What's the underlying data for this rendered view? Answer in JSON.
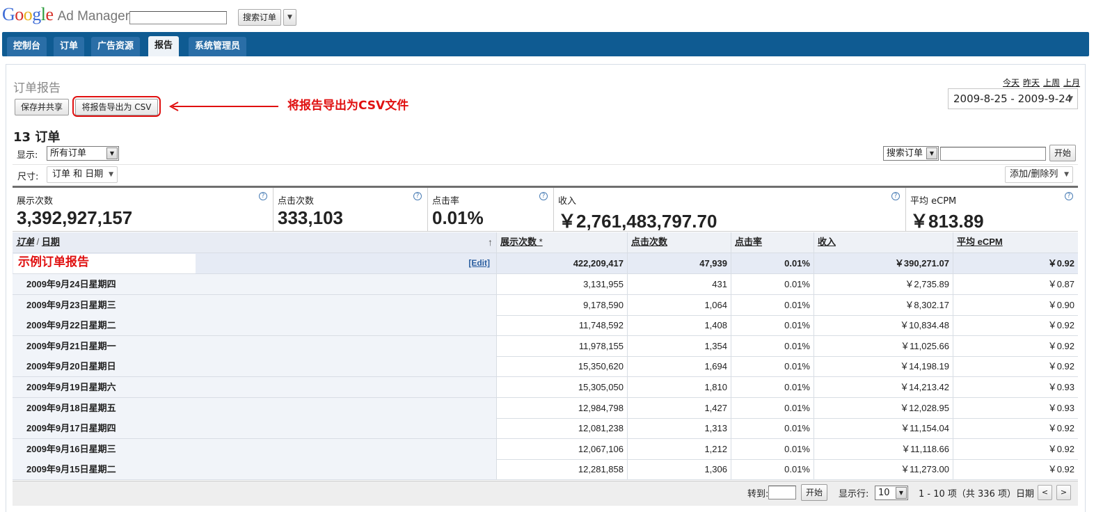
{
  "header": {
    "logo_google": "Google",
    "logo_product": "Ad Manager",
    "search_value": "",
    "search_button": "搜索订单",
    "dropdown_icon": "triangle-down"
  },
  "nav": {
    "tabs": [
      "控制台",
      "订单",
      "广告资源",
      "报告",
      "系统管理员"
    ],
    "active_tab": "报告"
  },
  "page": {
    "title": "订单报告",
    "save_share_button": "保存并共享",
    "export_csv_button": "将报告导出为 CSV",
    "annotation_top": "将报告导出为CSV文件",
    "date_shortcuts": [
      "今天",
      "昨天",
      "上周",
      "上月"
    ],
    "date_range": "2009-8-25 - 2009-9-24",
    "count_title": "13 订单",
    "show_label": "显示:",
    "show_value": "所有订单",
    "search_scope": "搜索订单",
    "search_input": "",
    "search_go": "开始",
    "dimension_label": "尺寸:",
    "dimension_value": "订单 和 日期",
    "add_remove_columns": "添加/删除列"
  },
  "summary": [
    {
      "label": "展示次数",
      "value": "3,392,927,157"
    },
    {
      "label": "点击次数",
      "value": "333,103"
    },
    {
      "label": "点击率",
      "value": "0.01%"
    },
    {
      "label": "收入",
      "value": "￥2,761,483,797.70"
    },
    {
      "label": "平均 eCPM",
      "value": "￥813.89"
    }
  ],
  "table": {
    "header_first": {
      "order": "订单",
      "sep": "/",
      "date": "日期"
    },
    "sort_icon": "↑",
    "columns": [
      "展示次数",
      "点击次数",
      "点击率",
      "收入",
      "平均 eCPM"
    ],
    "impressions_marker": "*",
    "group": {
      "name": "示例订单报告",
      "edit": "[Edit]",
      "impressions": "422,209,417",
      "clicks": "47,939",
      "ctr": "0.01%",
      "revenue": "￥390,271.07",
      "ecpm": "￥0.92"
    },
    "rows": [
      {
        "date": "2009年9月24日星期四",
        "impressions": "3,131,955",
        "clicks": "431",
        "ctr": "0.01%",
        "revenue": "￥2,735.89",
        "ecpm": "￥0.87"
      },
      {
        "date": "2009年9月23日星期三",
        "impressions": "9,178,590",
        "clicks": "1,064",
        "ctr": "0.01%",
        "revenue": "￥8,302.17",
        "ecpm": "￥0.90"
      },
      {
        "date": "2009年9月22日星期二",
        "impressions": "11,748,592",
        "clicks": "1,408",
        "ctr": "0.01%",
        "revenue": "￥10,834.48",
        "ecpm": "￥0.92"
      },
      {
        "date": "2009年9月21日星期一",
        "impressions": "11,978,155",
        "clicks": "1,354",
        "ctr": "0.01%",
        "revenue": "￥11,025.66",
        "ecpm": "￥0.92"
      },
      {
        "date": "2009年9月20日星期日",
        "impressions": "15,350,620",
        "clicks": "1,694",
        "ctr": "0.01%",
        "revenue": "￥14,198.19",
        "ecpm": "￥0.92"
      },
      {
        "date": "2009年9月19日星期六",
        "impressions": "15,305,050",
        "clicks": "1,810",
        "ctr": "0.01%",
        "revenue": "￥14,213.42",
        "ecpm": "￥0.93"
      },
      {
        "date": "2009年9月18日星期五",
        "impressions": "12,984,798",
        "clicks": "1,427",
        "ctr": "0.01%",
        "revenue": "￥12,028.95",
        "ecpm": "￥0.93"
      },
      {
        "date": "2009年9月17日星期四",
        "impressions": "12,081,238",
        "clicks": "1,313",
        "ctr": "0.01%",
        "revenue": "￥11,154.04",
        "ecpm": "￥0.92"
      },
      {
        "date": "2009年9月16日星期三",
        "impressions": "12,067,106",
        "clicks": "1,212",
        "ctr": "0.01%",
        "revenue": "￥11,118.66",
        "ecpm": "￥0.92"
      },
      {
        "date": "2009年9月15日星期二",
        "impressions": "12,281,858",
        "clicks": "1,306",
        "ctr": "0.01%",
        "revenue": "￥11,273.00",
        "ecpm": "￥0.92"
      }
    ]
  },
  "footer": {
    "goto_label": "转到:",
    "goto_value": "",
    "goto_button": "开始",
    "rows_label": "显示行:",
    "rows_value": "10",
    "range_text": "1 - 10 项（共 336 项）日期",
    "prev": "<",
    "next": ">"
  },
  "colors": {
    "nav_bg": "#0f5b92",
    "tab_bg": "#2a6ea7",
    "annotation_red": "#e01010",
    "link_blue": "#2a5d9f"
  }
}
